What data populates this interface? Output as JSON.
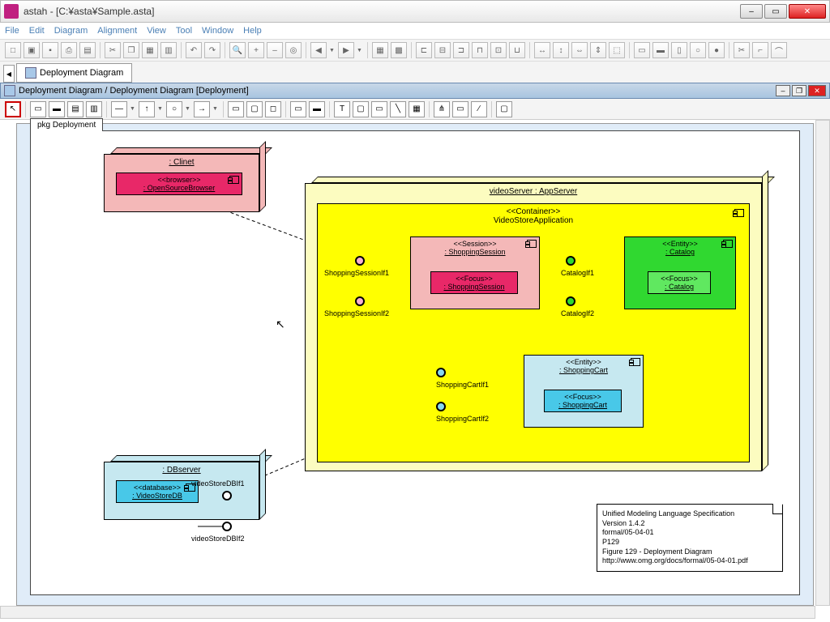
{
  "window": {
    "title": "astah - [C:¥asta¥Sample.asta]"
  },
  "menu": [
    "File",
    "Edit",
    "Diagram",
    "Alignment",
    "View",
    "Tool",
    "Window",
    "Help"
  ],
  "tab": {
    "label": "Deployment Diagram"
  },
  "doc": {
    "title": "Deployment Diagram / Deployment Diagram [Deployment]"
  },
  "pkg": "pkg Deployment",
  "client": {
    "title": ": Clinet",
    "stereo": "<<browser>>",
    "comp": ": OpenSourceBrowser"
  },
  "db": {
    "title": ": DBserver",
    "stereo": "<<database>>",
    "comp": ": VideoStoreDB",
    "if1": "videoStoreDBIf1",
    "if2": "videoStoreDBIf2"
  },
  "app": {
    "title": "videoServer : AppServer"
  },
  "container": {
    "stereo": "<<Container>>",
    "name": "VideoStoreApplication"
  },
  "session": {
    "stereo": "<<Session>>",
    "title": ": ShoppingSession",
    "fstereo": "<<Focus>>",
    "focus": ": ShoppingSession",
    "if1": "ShoppingSessionIf1",
    "if2": "ShoppingSessionIf2"
  },
  "catalog": {
    "stereo": "<<Entity>>",
    "title": ": Catalog",
    "fstereo": "<<Focus>>",
    "focus": ": Catalog",
    "if1": "CatalogIf1",
    "if2": "CatalogIf2"
  },
  "cart": {
    "stereo": "<<Entity>>",
    "title": ": ShoppingCart",
    "fstereo": "<<Focus>>",
    "focus": ": ShoppingCart",
    "if1": "ShoppingCartIf1",
    "if2": "ShoppingCartIf2"
  },
  "note": {
    "l1": "Unified Modeling Language Specification",
    "l2": "Version 1.4.2",
    "l3": "formal/05-04-01",
    "l4": "P129",
    "l5": "Figure 129 - Deployment Diagram",
    "l6": "http://www.omg.org/docs/formal/05-04-01.pdf"
  }
}
